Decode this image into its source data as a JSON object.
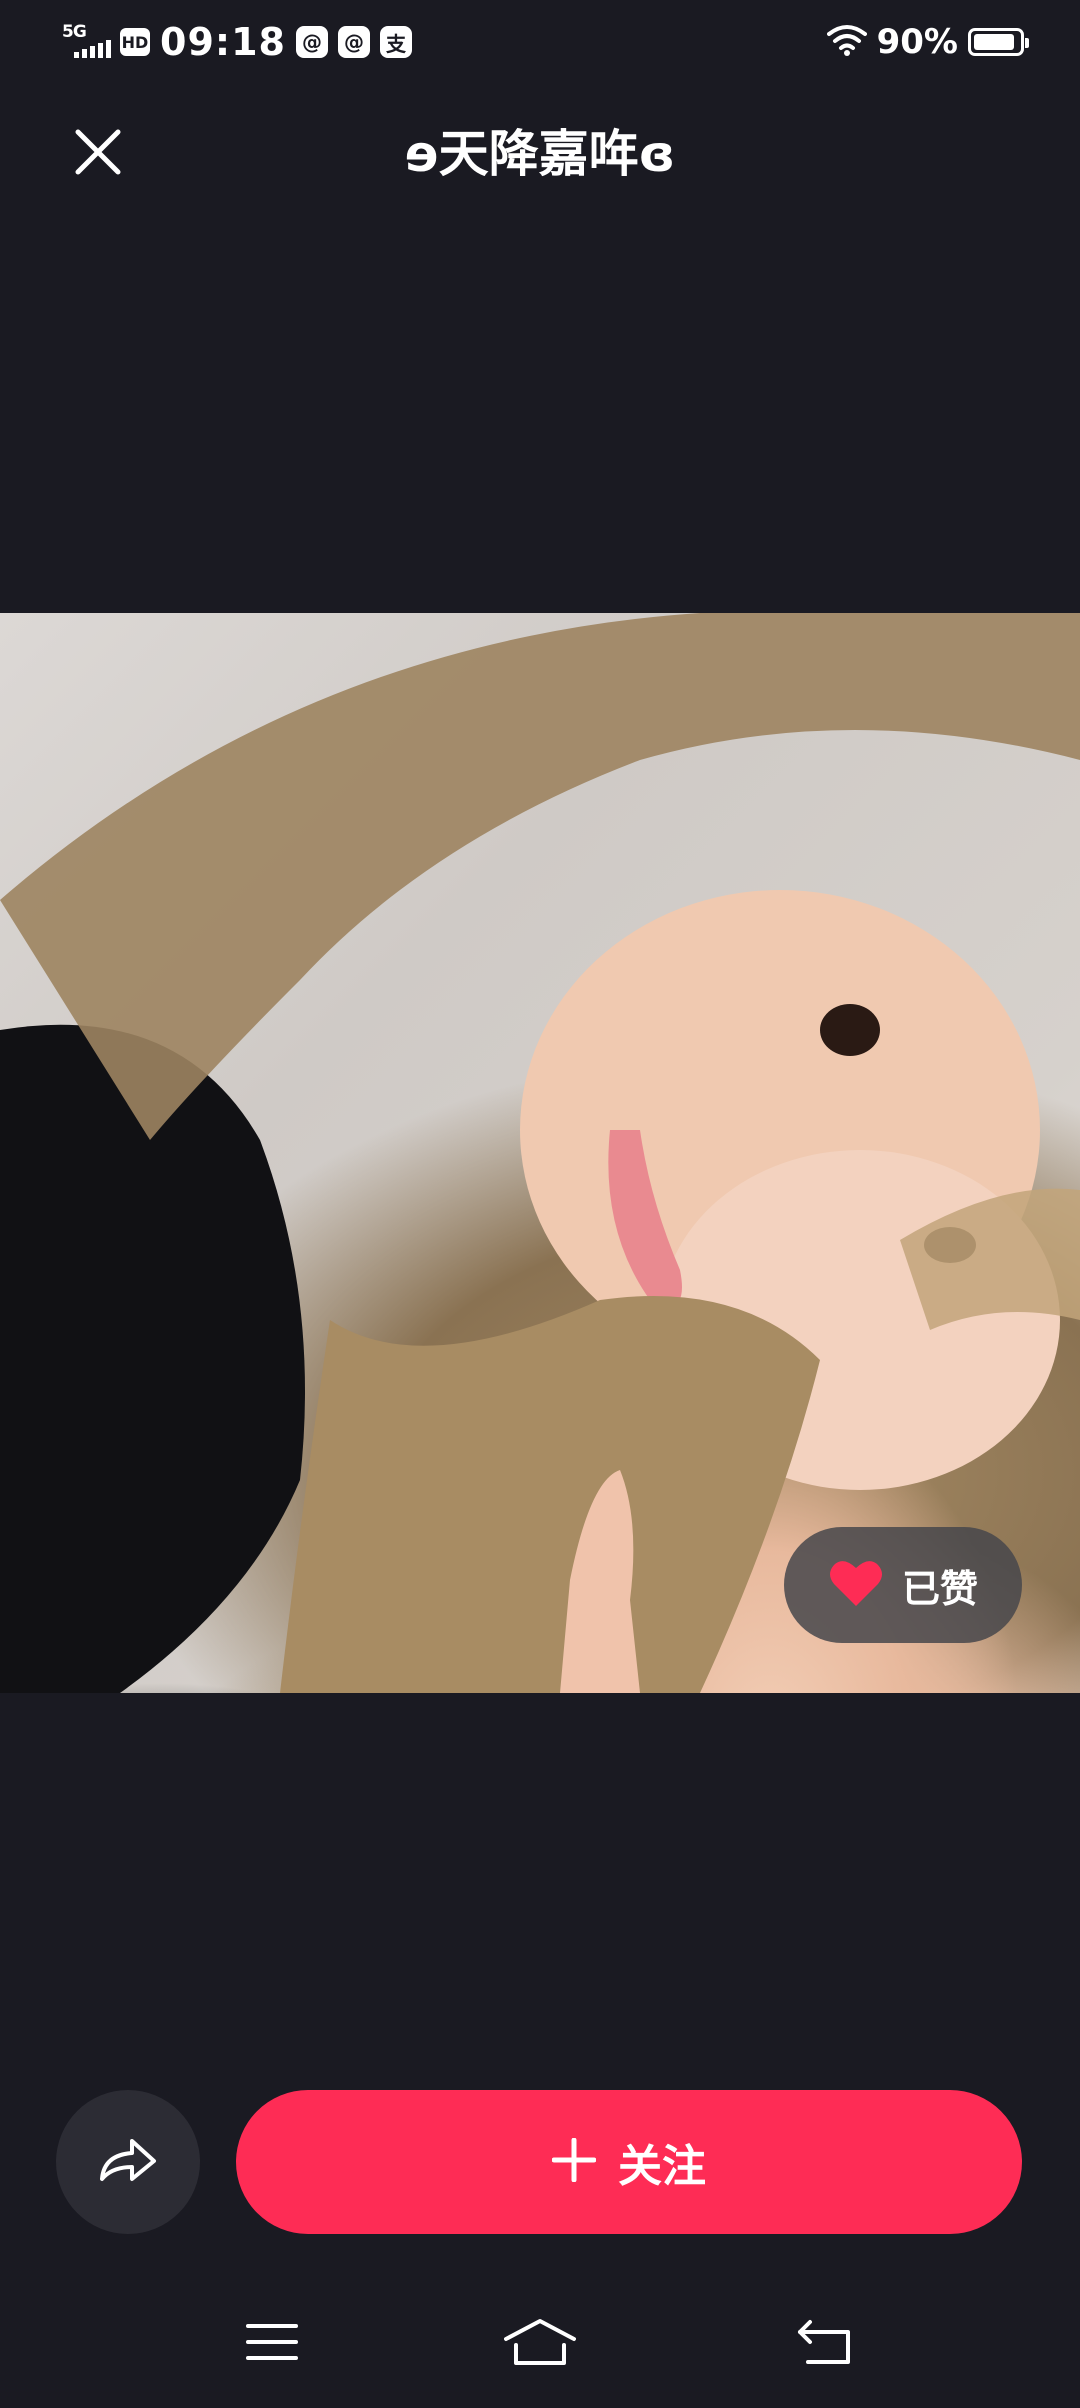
{
  "status_bar": {
    "network": "5G",
    "hd_badge": "HD",
    "time": "09:18",
    "app_icons": [
      "@",
      "@",
      "支"
    ],
    "battery_percent": "90%",
    "battery_level": 0.9
  },
  "header": {
    "title": "ɘ天降嘉哖ɞ",
    "close_icon": "close-icon"
  },
  "photo": {
    "liked_label": "已赞",
    "heart_color": "#fe2c55"
  },
  "actions": {
    "share_icon": "share-arrow-icon",
    "follow_label": "关注",
    "follow_plus_icon": "plus-icon",
    "follow_color": "#fe2c55"
  },
  "nav_bar": {
    "items": [
      "menu-icon",
      "home-icon",
      "back-icon"
    ]
  }
}
